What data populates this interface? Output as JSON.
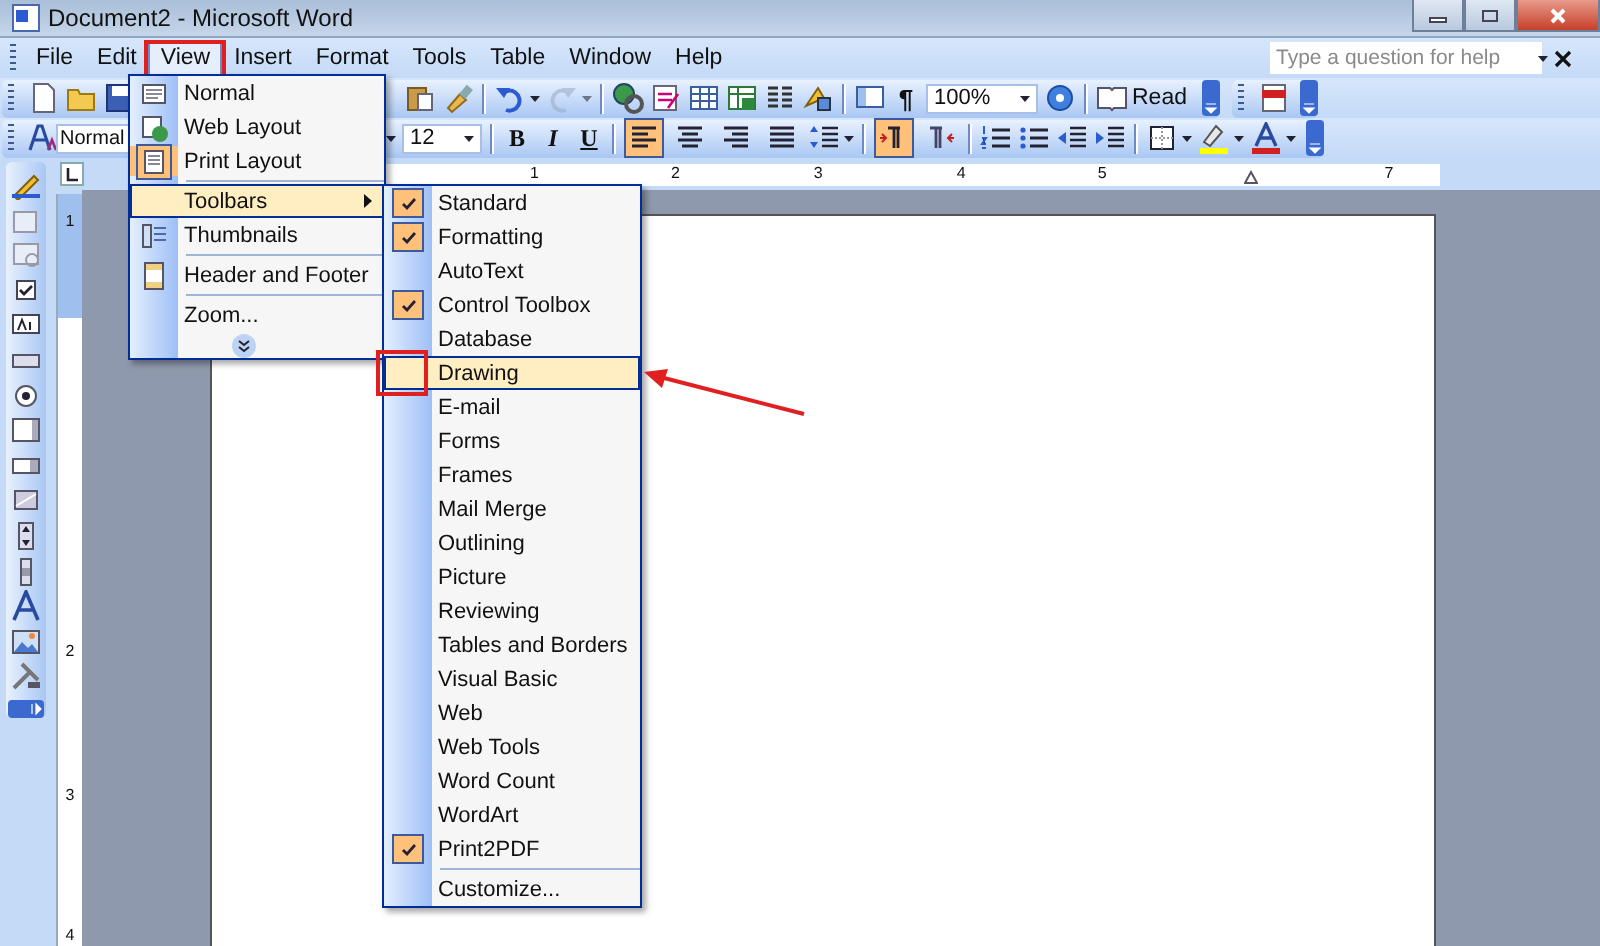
{
  "window": {
    "title": "Document2 - Microsoft Word"
  },
  "menu_bar": [
    {
      "label": "File",
      "selected": false,
      "annotated": false
    },
    {
      "label": "Edit",
      "selected": false,
      "annotated": false
    },
    {
      "label": "View",
      "selected": true,
      "annotated": true
    },
    {
      "label": "Insert",
      "selected": false,
      "annotated": false
    },
    {
      "label": "Format",
      "selected": false,
      "annotated": false
    },
    {
      "label": "Tools",
      "selected": false,
      "annotated": false
    },
    {
      "label": "Table",
      "selected": false,
      "annotated": false
    },
    {
      "label": "Window",
      "selected": false,
      "annotated": false
    },
    {
      "label": "Help",
      "selected": false,
      "annotated": false
    }
  ],
  "help_box": {
    "placeholder": "Type a question for help"
  },
  "standard_toolbar": {
    "show_marks": "¶",
    "zoom": "100%",
    "read_button": "Read"
  },
  "formatting_toolbar": {
    "style": "Normal",
    "font_size": "12",
    "text_buttons": [
      "B",
      "I",
      "U"
    ],
    "align_buttons": [
      {
        "selected": true
      },
      {
        "selected": false
      },
      {
        "selected": false
      },
      {
        "selected": false
      }
    ],
    "direction_buttons": [
      {
        "selected": true
      },
      {
        "selected": false
      }
    ]
  },
  "ruler": {
    "numbers": [
      "1",
      "2",
      "3",
      "4",
      "5",
      "7"
    ]
  },
  "vertical_ruler": {
    "numbers": [
      "1",
      "2",
      "3",
      "4"
    ]
  },
  "view_menu": {
    "items": [
      {
        "label": "Normal",
        "selected": false,
        "current": false,
        "submenu": false,
        "separator_before": false
      },
      {
        "label": "Web Layout",
        "selected": false,
        "current": false,
        "submenu": false,
        "separator_before": false
      },
      {
        "label": "Print Layout",
        "selected": false,
        "current": true,
        "submenu": false,
        "separator_before": false
      },
      {
        "label": "Toolbars",
        "selected": true,
        "current": false,
        "submenu": true,
        "separator_before": true
      },
      {
        "label": "Thumbnails",
        "selected": false,
        "current": false,
        "submenu": false,
        "separator_before": false
      },
      {
        "label": "Header and Footer",
        "selected": false,
        "current": false,
        "submenu": false,
        "separator_before": true
      },
      {
        "label": "Zoom...",
        "selected": false,
        "current": false,
        "submenu": false,
        "separator_before": true
      }
    ]
  },
  "toolbars_menu": {
    "items": [
      {
        "label": "Standard",
        "checked": true,
        "selected": false,
        "annotated": false
      },
      {
        "label": "Formatting",
        "checked": true,
        "selected": false,
        "annotated": false
      },
      {
        "label": "AutoText",
        "checked": false,
        "selected": false,
        "annotated": false
      },
      {
        "label": "Control Toolbox",
        "checked": true,
        "selected": false,
        "annotated": false
      },
      {
        "label": "Database",
        "checked": false,
        "selected": false,
        "annotated": false
      },
      {
        "label": "Drawing",
        "checked": false,
        "selected": true,
        "annotated": true
      },
      {
        "label": "E-mail",
        "checked": false,
        "selected": false,
        "annotated": false
      },
      {
        "label": "Forms",
        "checked": false,
        "selected": false,
        "annotated": false
      },
      {
        "label": "Frames",
        "checked": false,
        "selected": false,
        "annotated": false
      },
      {
        "label": "Mail Merge",
        "checked": false,
        "selected": false,
        "annotated": false
      },
      {
        "label": "Outlining",
        "checked": false,
        "selected": false,
        "annotated": false
      },
      {
        "label": "Picture",
        "checked": false,
        "selected": false,
        "annotated": false
      },
      {
        "label": "Reviewing",
        "checked": false,
        "selected": false,
        "annotated": false
      },
      {
        "label": "Tables and Borders",
        "checked": false,
        "selected": false,
        "annotated": false
      },
      {
        "label": "Visual Basic",
        "checked": false,
        "selected": false,
        "annotated": false
      },
      {
        "label": "Web",
        "checked": false,
        "selected": false,
        "annotated": false
      },
      {
        "label": "Web Tools",
        "checked": false,
        "selected": false,
        "annotated": false
      },
      {
        "label": "Word Count",
        "checked": false,
        "selected": false,
        "annotated": false
      },
      {
        "label": "WordArt",
        "checked": false,
        "selected": false,
        "annotated": false
      },
      {
        "label": "Print2PDF",
        "checked": true,
        "selected": false,
        "annotated": false
      }
    ],
    "customize": "Customize..."
  }
}
